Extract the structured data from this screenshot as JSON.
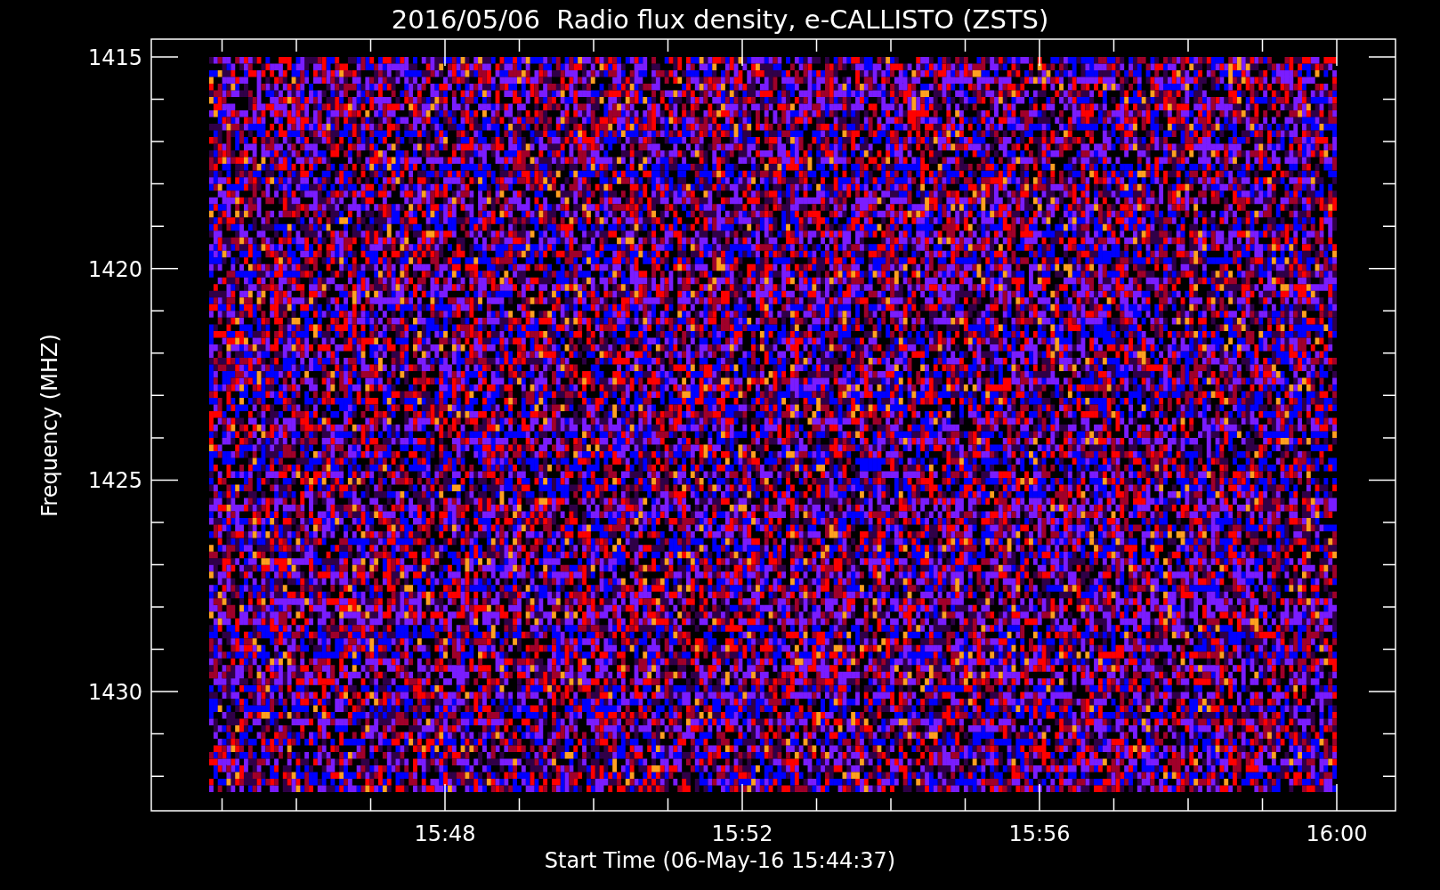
{
  "title": "2016/05/06  Radio flux density, e-CALLISTO (ZSTS)",
  "y_axis": {
    "label": "Frequency (MHZ)",
    "ticks": [
      "1415",
      "1420",
      "1425",
      "1430"
    ]
  },
  "x_axis": {
    "label": "Start Time (06-May-16 15:44:37)",
    "ticks": [
      "15:48",
      "15:52",
      "15:56",
      "16:00"
    ]
  }
}
